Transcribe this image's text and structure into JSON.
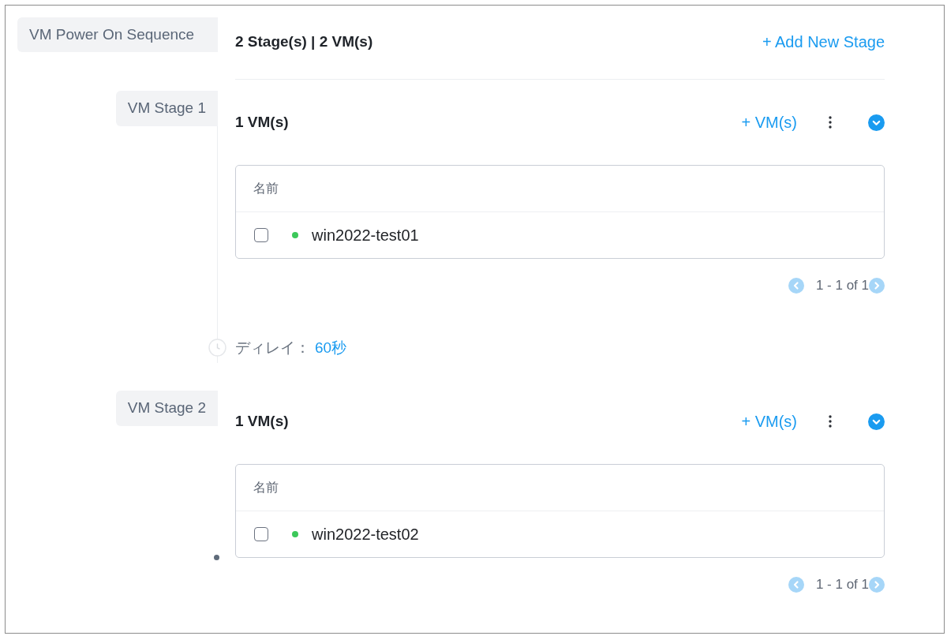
{
  "sequence": {
    "label": "VM Power On Sequence",
    "summary": "2 Stage(s) | 2 VM(s)",
    "add_stage": "+ Add New Stage"
  },
  "stages": [
    {
      "label": "VM Stage 1",
      "vm_count": "1 VM(s)",
      "add_vm": "+ VM(s)",
      "expanded": true,
      "table": {
        "columns": [
          "名前"
        ],
        "rows": [
          {
            "checked": false,
            "color": "#3cc85a",
            "name": "win2022-test01"
          }
        ]
      },
      "pagination": {
        "text": "1 - 1 of 1",
        "prev_disabled": true,
        "next_disabled": true
      },
      "delay": {
        "label": "ディレイ：",
        "value": "60秒"
      }
    },
    {
      "label": "VM Stage 2",
      "vm_count": "1 VM(s)",
      "add_vm": "+ VM(s)",
      "expanded": true,
      "table": {
        "columns": [
          "名前"
        ],
        "rows": [
          {
            "checked": false,
            "color": "#3cc85a",
            "name": "win2022-test02"
          }
        ]
      },
      "pagination": {
        "text": "1 - 1 of 1",
        "prev_disabled": true,
        "next_disabled": true
      }
    }
  ]
}
